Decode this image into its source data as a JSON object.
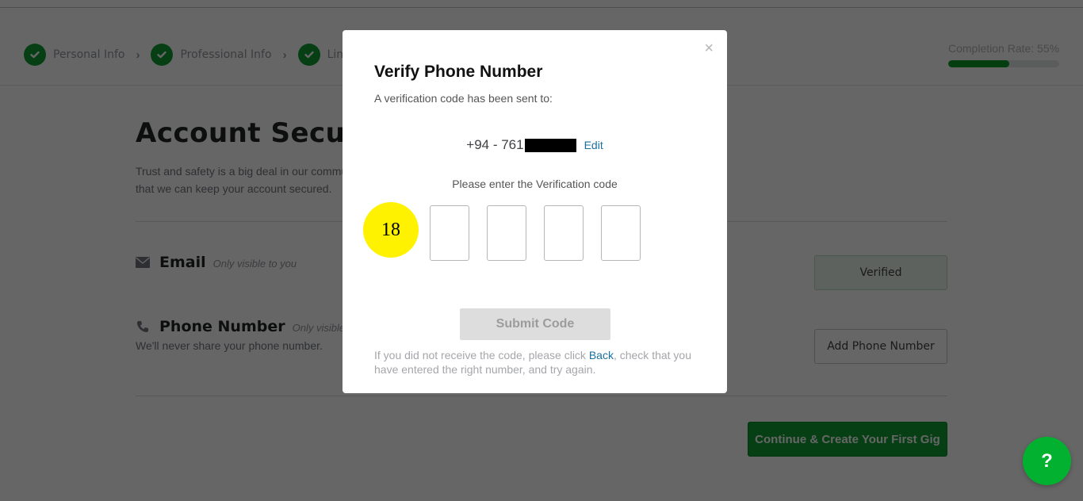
{
  "header": {
    "steps": [
      {
        "label": "Personal Info",
        "completed": true
      },
      {
        "label": "Professional Info",
        "completed": true
      },
      {
        "label": "Linked Accounts",
        "completed": true
      }
    ],
    "step_separator": "›",
    "completion": {
      "label": "Completion Rate: 55%",
      "percent": 55
    }
  },
  "main": {
    "title": "Account Security",
    "intro": "Trust and safety is a big deal in our community. Please verify your email and phone number so that we can keep your account secured.",
    "email": {
      "title": "Email",
      "note": "Only visible to you",
      "button_label": "Verified",
      "icon": "envelope-icon"
    },
    "phone": {
      "title": "Phone Number",
      "note": "Only visible to you",
      "sub": "We'll never share your phone number.",
      "button_label": "Add Phone Number",
      "icon": "phone-icon"
    },
    "continue_label": "Continue & Create Your First Gig"
  },
  "help_fab": {
    "label": "?"
  },
  "modal": {
    "close_label": "×",
    "title": "Verify Phone Number",
    "subtitle": "A verification code has been sent to:",
    "phone_prefix": "+94 - 761",
    "edit_label": "Edit",
    "code_prompt": "Please enter the Verification code",
    "code_values": [
      "",
      "",
      "",
      ""
    ],
    "marker_label": "18",
    "submit_label": "Submit Code",
    "help_before": "If you did not receive the code, please click ",
    "back_label": "Back",
    "help_after": ", check that you have entered the right number, and try again."
  },
  "colors": {
    "brand_green": "#0f9d33",
    "link_blue": "#1a6fa1",
    "marker_yellow": "#fff200",
    "help_fab_green": "#03b130"
  }
}
